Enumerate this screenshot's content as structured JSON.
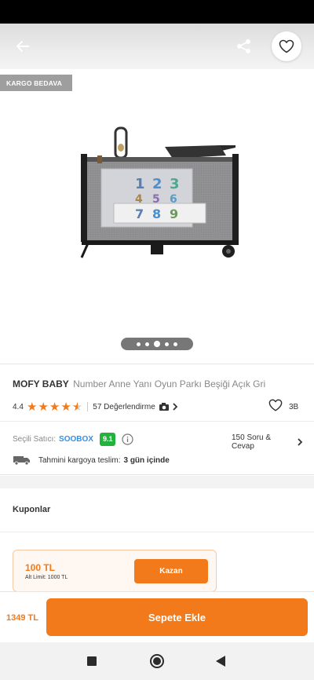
{
  "header": {
    "back_icon": "arrow-left-icon",
    "share_icon": "share-icon",
    "favorite_icon": "heart-outline-icon"
  },
  "badge": {
    "label": "KARGO BEDAVA",
    "color": "#9e9e9e"
  },
  "gallery": {
    "image_count": 5,
    "active_index": 2
  },
  "product": {
    "brand": "MOFY BABY",
    "name": "Number Anne Yanı Oyun Parkı Beşiği Açık Gri",
    "rating": "4.4",
    "rating_value": 4.4,
    "stars_max": 5,
    "reviews_label": "57 Değerlendirme",
    "likes": "3B"
  },
  "seller": {
    "label": "Seçili Satıcı:",
    "name": "SOOBOX",
    "score": "9.1",
    "score_color": "#22b33e",
    "qa_label": "150 Soru & Cevap"
  },
  "delivery": {
    "label": "Tahmini kargoya teslim:",
    "value": "3 gün içinde"
  },
  "coupons": {
    "title": "Kuponlar",
    "card": {
      "amount": "100 TL",
      "limit": "Alt Limit: 1000 TL",
      "button_label": "Kazan"
    }
  },
  "cart": {
    "price": "1349 TL",
    "button_label": "Sepete Ekle",
    "accent_color": "#f27a1a"
  }
}
